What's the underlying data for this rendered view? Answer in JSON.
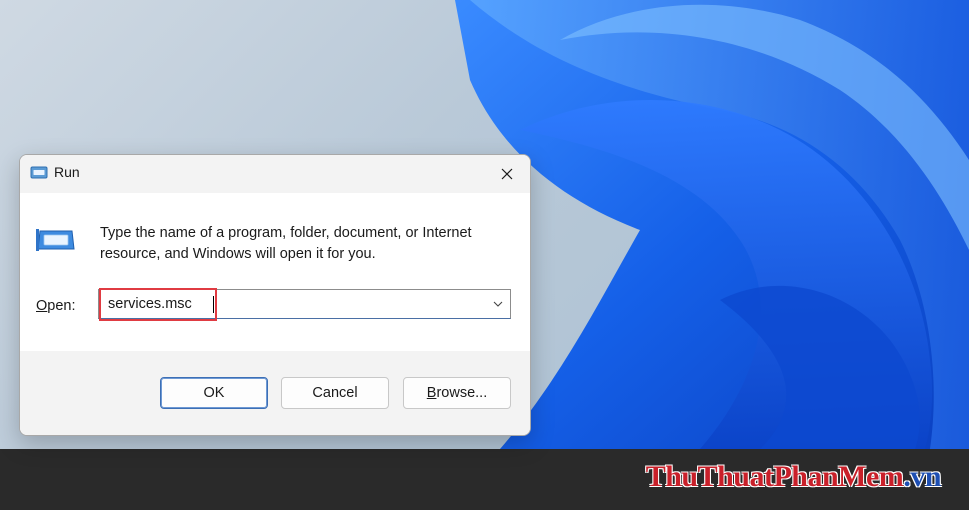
{
  "dialog": {
    "title": "Run",
    "description": "Type the name of a program, folder, document, or Internet resource, and Windows will open it for you.",
    "open_label_accel": "O",
    "open_label_rest": "pen:",
    "input_value": "services.msc",
    "buttons": {
      "ok": "OK",
      "cancel": "Cancel",
      "browse_accel": "B",
      "browse_rest": "rowse..."
    }
  },
  "watermark": {
    "text_main": "ThuThuatPhanMem",
    "text_suffix": ".vn"
  },
  "colors": {
    "highlight_border": "#e03b42",
    "taskbar": "#2a2a2a",
    "accent_blue": "#1e6ae8"
  },
  "icons": [
    "run-app-icon",
    "close-icon",
    "chevron-down-icon"
  ]
}
